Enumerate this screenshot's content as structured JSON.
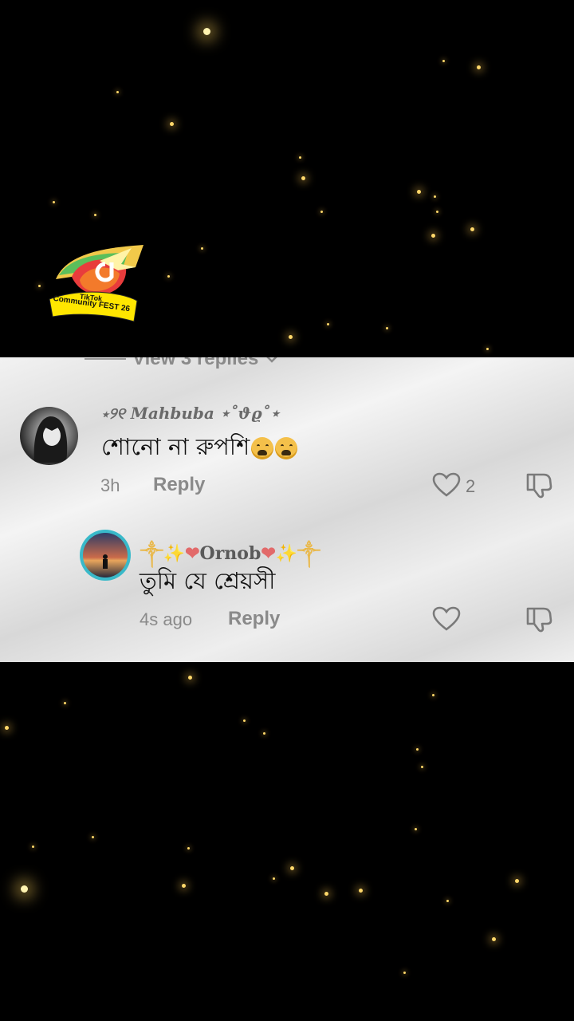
{
  "background": {
    "color": "#000000",
    "sparkle_color": "#ffd86a"
  },
  "badge": {
    "brand": "TikTok",
    "line": "Community FEST 26"
  },
  "comments_panel": {
    "view_replies_label": "View 3 replies",
    "comments": [
      {
        "username": "⋆୨୧ Mahbuba ⋆˚ϑϱ˚⋆",
        "text": "শোনো না রুপশি",
        "emoji_count": 2,
        "time": "3h",
        "reply_label": "Reply",
        "like_count": "2"
      },
      {
        "username_prefix": "༒✨",
        "username": "Ornob",
        "username_suffix": "✨༒",
        "text": "তুমি যে শ্রেয়সী",
        "time": "4s ago",
        "reply_label": "Reply",
        "like_count": ""
      }
    ]
  }
}
